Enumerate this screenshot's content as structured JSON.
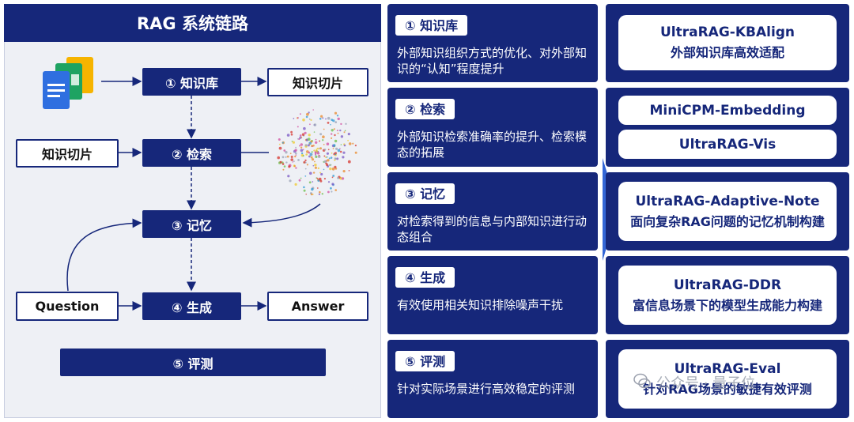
{
  "left": {
    "title": "RAG 系统链路",
    "steps": {
      "kb": "① 知识库",
      "retrieve": "② 检索",
      "memory": "③ 记忆",
      "generate": "④ 生成",
      "evaluate": "⑤ 评测"
    },
    "chunk_top": "知识切片",
    "chunk_left": "知识切片",
    "question": "Question",
    "answer": "Answer"
  },
  "middle": [
    {
      "label": "① 知识库",
      "desc": "外部知识组织方式的优化、对外部知识的“认知”程度提升"
    },
    {
      "label": "② 检索",
      "desc": "外部知识检索准确率的提升、检索模态的拓展"
    },
    {
      "label": "③ 记忆",
      "desc": "对检索得到的信息与内部知识进行动态组合"
    },
    {
      "label": "④ 生成",
      "desc": "有效使用相关知识排除噪声干扰"
    },
    {
      "label": "⑤ 评测",
      "desc": "针对实际场景进行高效稳定的评测"
    }
  ],
  "right": {
    "kbalign_title": "UltraRAG-KBAlign",
    "kbalign_sub": "外部知识库高效适配",
    "minicpm": "MiniCPM-Embedding",
    "vis": "UltraRAG-Vis",
    "adaptive_title": "UltraRAG-Adaptive-Note",
    "adaptive_sub": "面向复杂RAG问题的记忆机制构建",
    "ddr_title": "UltraRAG-DDR",
    "ddr_sub": "富信息场景下的模型生成能力构建",
    "eval_title": "UltraRAG-Eval",
    "eval_sub": "针对RAG场景的敏捷有效评测"
  },
  "watermark": "公众号 · 量子位",
  "colors": {
    "navy": "#16277a",
    "panel": "#eef0f5",
    "arrow": "#16277a"
  },
  "icons": [
    "docs-icon",
    "point-cloud-icon",
    "wechat-icon"
  ]
}
